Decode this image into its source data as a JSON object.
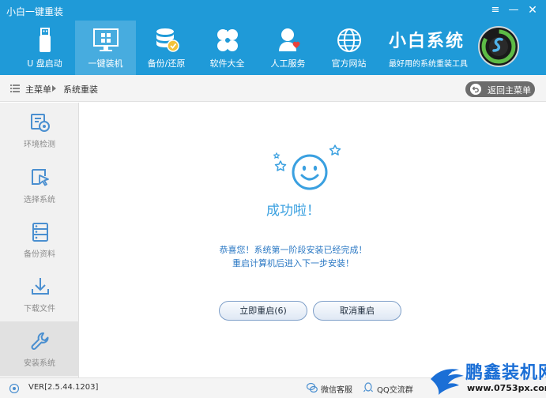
{
  "window": {
    "title": "小白一键重装"
  },
  "nav": {
    "items": [
      {
        "label": "U 盘启动",
        "icon": "usb-drive-icon",
        "active": false
      },
      {
        "label": "一键装机",
        "icon": "monitor-windows-icon",
        "active": true
      },
      {
        "label": "备份/还原",
        "icon": "database-backup-icon",
        "active": false
      },
      {
        "label": "软件大全",
        "icon": "apps-grid-icon",
        "active": false
      },
      {
        "label": "人工服务",
        "icon": "support-person-icon",
        "active": false
      },
      {
        "label": "官方网站",
        "icon": "globe-icon",
        "active": false
      }
    ]
  },
  "brand": {
    "name": "小白系统",
    "slogan": "最好用的系统重装工具",
    "logo_icon": "xiaobai-logo-icon"
  },
  "breadcrumb": {
    "home": "主菜单",
    "current": "系统重装"
  },
  "back_button": {
    "label": "返回主菜单"
  },
  "sidebar": {
    "items": [
      {
        "label": "环境检测",
        "icon": "environment-check-icon",
        "active": false
      },
      {
        "label": "选择系统",
        "icon": "select-cursor-icon",
        "active": false
      },
      {
        "label": "备份资料",
        "icon": "backup-cabinet-icon",
        "active": false
      },
      {
        "label": "下载文件",
        "icon": "download-icon",
        "active": false
      },
      {
        "label": "安装系统",
        "icon": "wrench-icon",
        "active": true
      }
    ]
  },
  "main": {
    "title": "成功啦！",
    "message_line1": "恭喜您！系统第一阶段安装已经完成！",
    "message_line2": "重启计算机后进入下一步安装！",
    "restart_button": "立即重启(6)",
    "cancel_button": "取消重启"
  },
  "footer": {
    "version": "VER[2.5.44.1203]",
    "wechat": "微信客服",
    "qq": "QQ交流群"
  },
  "watermark": {
    "text": "鹏鑫装机网",
    "url": "www.0753px.com"
  },
  "colors": {
    "header_blue": "#1f9ad8",
    "accent_blue": "#3aa0e0",
    "message_blue": "#2c79c4",
    "watermark_blue": "#1b6fd6"
  }
}
